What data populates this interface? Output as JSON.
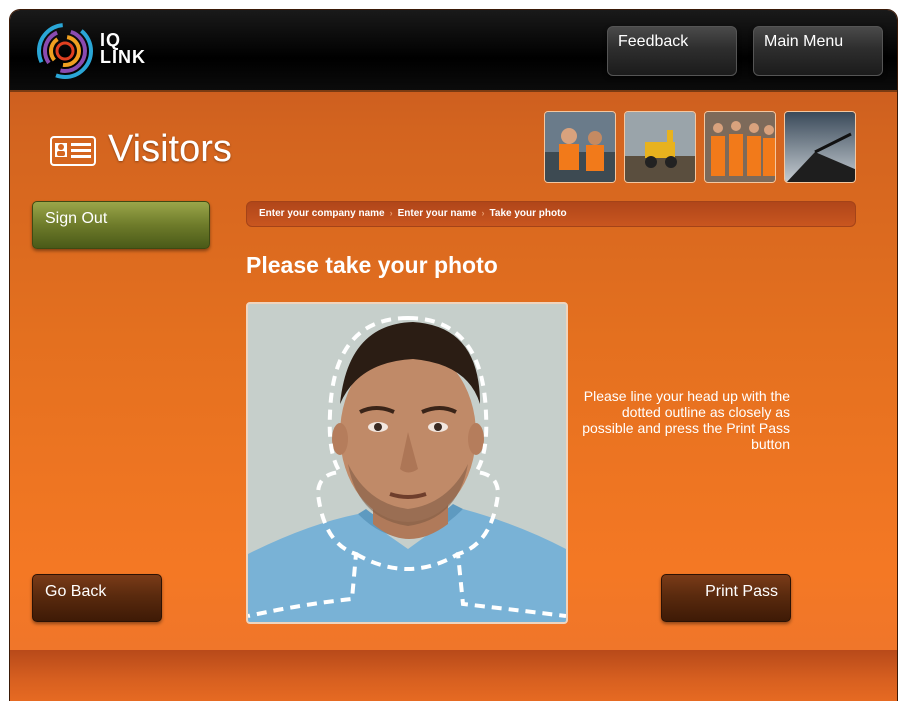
{
  "app": {
    "logo_text_line1": "IQ",
    "logo_text_line2": "LINK"
  },
  "header": {
    "feedback_label": "Feedback",
    "main_menu_label": "Main Menu"
  },
  "page": {
    "title": "Visitors",
    "heading": "Please take your photo",
    "instruction": "Please line your head up with the dotted outline as closely as possible and press the Print Pass button"
  },
  "breadcrumb": {
    "steps": [
      "Enter your company name",
      "Enter your name",
      "Take your photo"
    ]
  },
  "buttons": {
    "sign_out": "Sign Out",
    "go_back": "Go Back",
    "print_pass": "Print Pass"
  },
  "colors": {
    "accent_orange": "#f47824",
    "sign_out_green": "#6e7b2a",
    "dark_brown_button": "#5a2a0e"
  }
}
